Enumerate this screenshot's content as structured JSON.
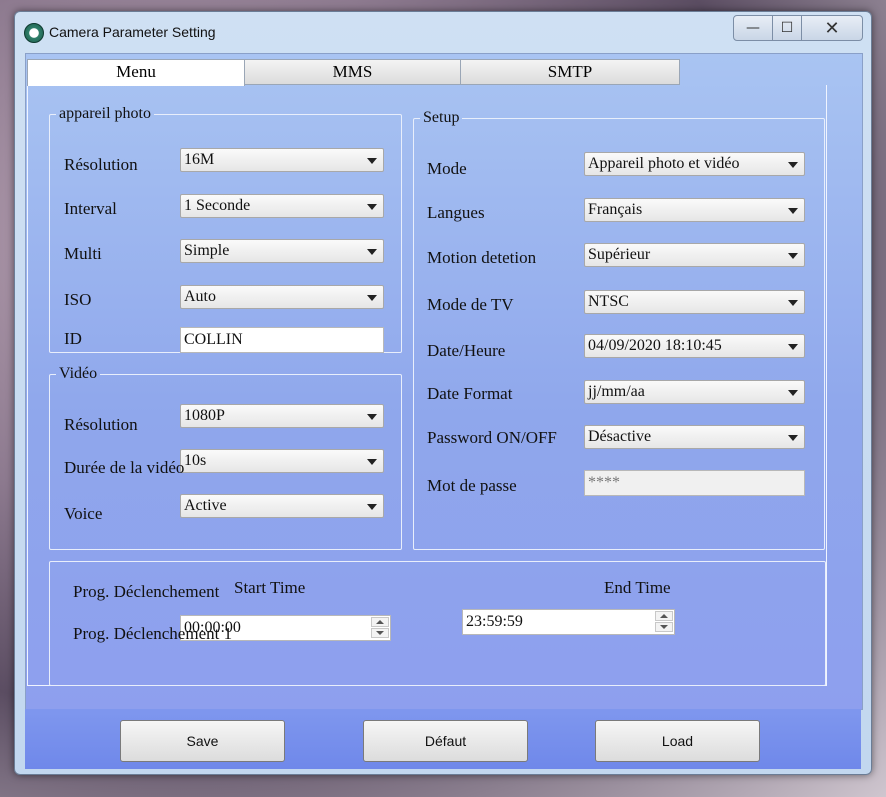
{
  "window": {
    "title": "Camera Parameter Setting",
    "min_glyph": "—",
    "max_glyph": "☐",
    "close_glyph": "✕"
  },
  "tabs": [
    {
      "label": "Menu",
      "active": true
    },
    {
      "label": "MMS",
      "active": false
    },
    {
      "label": "SMTP",
      "active": false
    }
  ],
  "photo": {
    "legend": "appareil photo",
    "resolution": {
      "label": "Résolution",
      "value": "16M"
    },
    "interval": {
      "label": "Interval",
      "value": "1 Seconde"
    },
    "multi": {
      "label": "Multi",
      "value": "Simple"
    },
    "iso": {
      "label": "ISO",
      "value": "Auto"
    },
    "id": {
      "label": "ID",
      "value": "COLLIN"
    }
  },
  "video": {
    "legend": "Vidéo",
    "resolution": {
      "label": "Résolution",
      "value": "1080P"
    },
    "duration": {
      "label": "Durée de la vidéo",
      "value": "10s"
    },
    "voice": {
      "label": "Voice",
      "value": "Active"
    }
  },
  "setup": {
    "legend": "Setup",
    "mode": {
      "label": "Mode",
      "value": "Appareil photo et vidéo"
    },
    "langues": {
      "label": "Langues",
      "value": "Français"
    },
    "motion": {
      "label": "Motion detetion",
      "value": "Supérieur"
    },
    "tv_mode": {
      "label": "Mode de TV",
      "value": "NTSC"
    },
    "datetime": {
      "label": "Date/Heure",
      "value": "04/09/2020 18:10:45"
    },
    "date_format": {
      "label": "Date Format",
      "value": "jj/mm/aa"
    },
    "password_onoff": {
      "label": "Password ON/OFF",
      "value": "Désactive"
    },
    "password": {
      "label": "Mot de passe",
      "value": "****"
    }
  },
  "schedule": {
    "label_main": "Prog. Déclenchement",
    "label_1": "Prog. Déclenchement 1",
    "start_time_label": "Start Time",
    "end_time_label": "End Time",
    "start_time_value": "00:00:00",
    "end_time_value": "23:59:59"
  },
  "buttons": {
    "save": "Save",
    "default": "Défaut",
    "load": "Load"
  }
}
